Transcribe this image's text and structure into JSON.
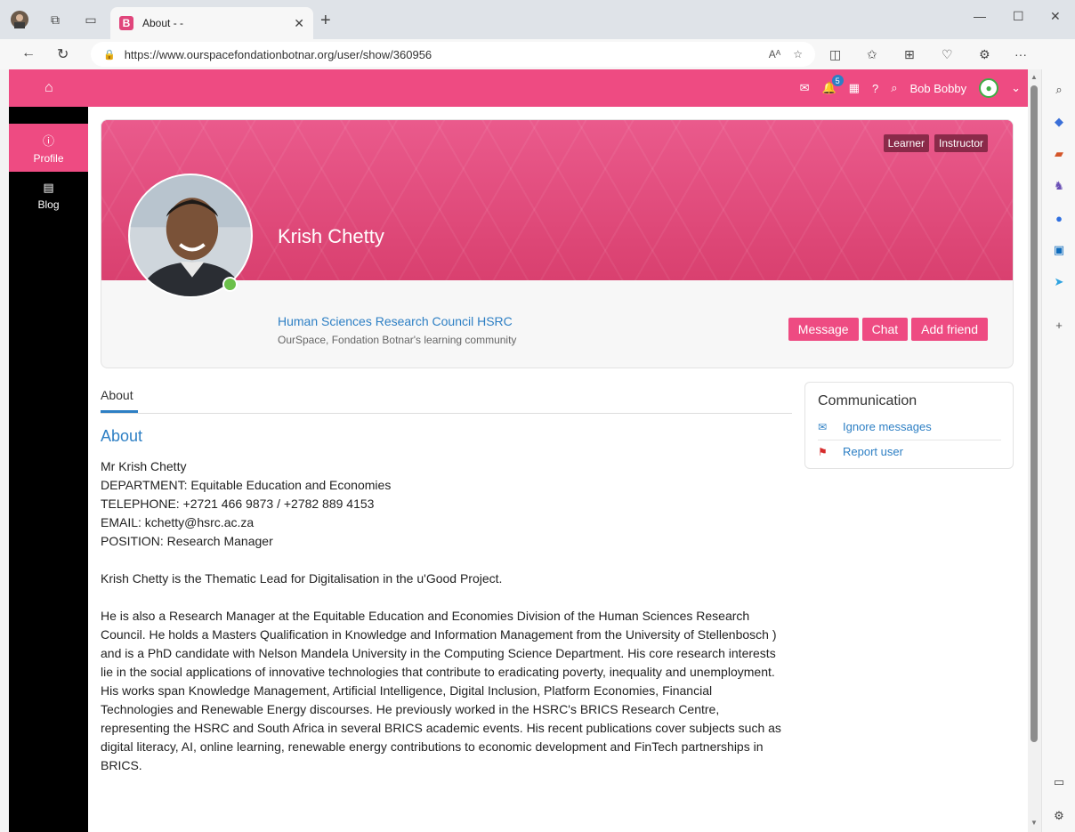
{
  "browser": {
    "tab_title": "About - -",
    "tab_favicon": "B",
    "url": "https://www.ourspacefondationbotnar.org/user/show/360956",
    "read_aloud_label": "Aᴬ"
  },
  "topnav": {
    "notification_count": "5",
    "user_name": "Bob Bobby"
  },
  "leftnav": {
    "items": [
      {
        "label": "Profile",
        "icon": "info-icon"
      },
      {
        "label": "Blog",
        "icon": "calendar-icon"
      }
    ]
  },
  "profile": {
    "roles": [
      "Learner",
      "Instructor"
    ],
    "name": "Krish Chetty",
    "organization": "Human Sciences Research Council HSRC",
    "community": "OurSpace, Fondation Botnar's learning community",
    "actions": [
      "Message",
      "Chat",
      "Add friend"
    ]
  },
  "tabs": {
    "about": "About"
  },
  "about": {
    "heading": "About",
    "lines": [
      "Mr Krish Chetty",
      "DEPARTMENT: Equitable Education and Economies",
      "TELEPHONE: +2721 466 9873 / +2782 889 4153",
      "EMAIL: kchetty@hsrc.ac.za",
      "POSITION: Research Manager"
    ],
    "para1": "Krish Chetty is the Thematic Lead for Digitalisation in the u'Good Project.",
    "para2": "He is also a Research Manager at the Equitable Education and Economies Division of the Human Sciences Research Council. He holds a Masters Qualification in Knowledge and Information Management from the University of Stellenbosch ) and is a PhD candidate with Nelson Mandela University in the Computing Science Department. His core research interests lie in the social applications of innovative technologies that contribute to eradicating poverty, inequality and unemployment. His works span Knowledge Management, Artificial Intelligence, Digital Inclusion, Platform Economies, Financial Technologies and Renewable Energy discourses. He previously worked in the HSRC's BRICS Research Centre, representing the HSRC and South Africa in several BRICS academic events. His recent publications cover subjects such as digital literacy, AI, online learning, renewable energy contributions to economic development and FinTech partnerships in BRICS."
  },
  "communication": {
    "title": "Communication",
    "ignore": "Ignore messages",
    "report": "Report user"
  },
  "colors": {
    "brand": "#ee4b82",
    "link": "#2d7fc4",
    "online": "#6cc04a"
  }
}
